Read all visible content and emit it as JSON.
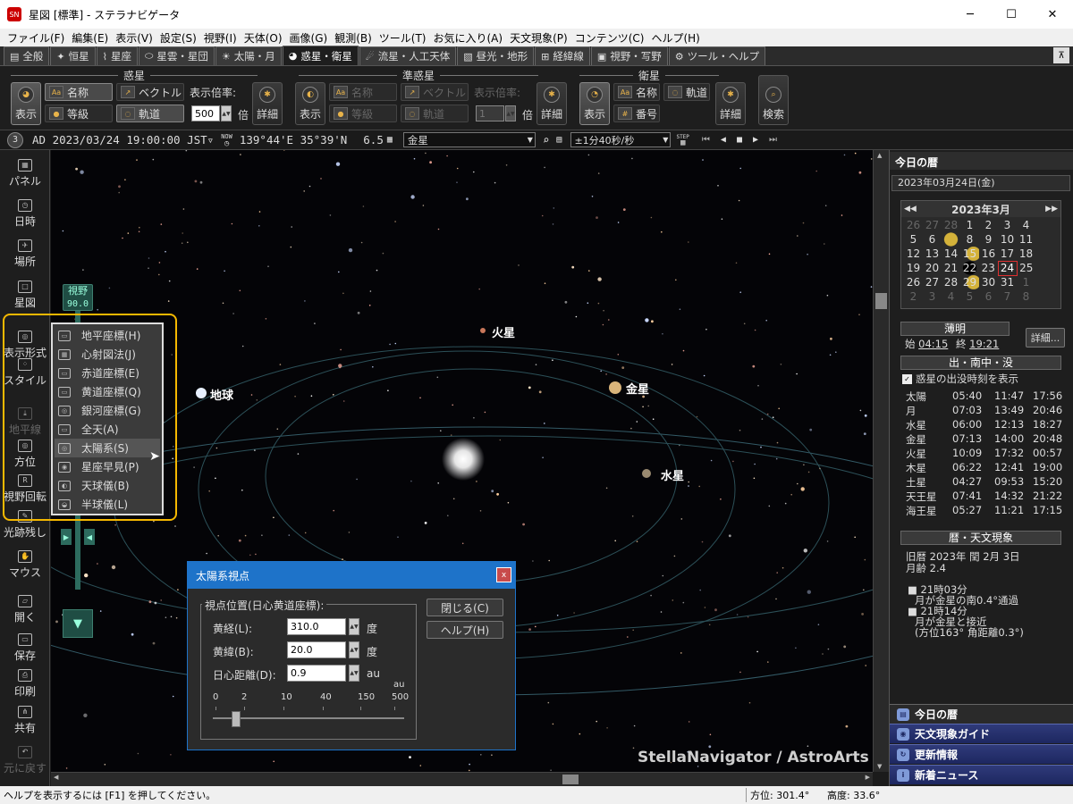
{
  "window": {
    "title": "星図 [標準] - ステラナビゲータ",
    "app_icon": "SN",
    "minimize": "─",
    "maximize": "☐",
    "close": "✕"
  },
  "menu": [
    "ファイル(F)",
    "編集(E)",
    "表示(V)",
    "設定(S)",
    "視野(I)",
    "天体(O)",
    "画像(G)",
    "観測(B)",
    "ツール(T)",
    "お気に入り(A)",
    "天文現象(P)",
    "コンテンツ(C)",
    "ヘルプ(H)"
  ],
  "tabs": [
    {
      "label": "全般",
      "icon": "▤"
    },
    {
      "label": "恒星",
      "icon": "✦"
    },
    {
      "label": "星座",
      "icon": "⌇"
    },
    {
      "label": "星雲・星団",
      "icon": "⬭"
    },
    {
      "label": "太陽・月",
      "icon": "☀"
    },
    {
      "label": "惑星・衛星",
      "icon": "◕",
      "active": true
    },
    {
      "label": "流星・人工天体",
      "icon": "☄"
    },
    {
      "label": "昼光・地形",
      "icon": "▧"
    },
    {
      "label": "経緯線",
      "icon": "⊞"
    },
    {
      "label": "視野・写野",
      "icon": "▣"
    },
    {
      "label": "ツール・ヘルプ",
      "icon": "⚙"
    }
  ],
  "pin": "⊼",
  "ribbon": {
    "groups": [
      "惑星",
      "準惑星",
      "衛星"
    ],
    "show": "表示",
    "detail": "詳細",
    "search": "検索",
    "name": "名称",
    "vector": "ベクトル",
    "grade": "等級",
    "orbit": "軌道",
    "number": "番号",
    "scale_label": "表示倍率:",
    "scale_unit": "倍",
    "scale_value": "500",
    "scale_value_dim": "1"
  },
  "status": {
    "step": "3",
    "datetime": "AD 2023/03/24 19:00:00 JST▿",
    "now": "NOW",
    "location": "139°44'E 35°39'N",
    "mag": "6.5",
    "target": "金星",
    "speed": "±1分40秒/秒",
    "step_label": "STEP"
  },
  "leftbar": [
    {
      "label": "パネル",
      "icon": "▦"
    },
    {
      "label": "日時",
      "icon": "◷"
    },
    {
      "label": "場所",
      "icon": "✈"
    },
    {
      "label": "星図",
      "icon": "□"
    },
    {
      "label": "表示形式",
      "icon": "◎"
    },
    {
      "label": "スタイル",
      "icon": "⁘"
    },
    {
      "label": "地平線",
      "icon": "⤓",
      "dim": true
    },
    {
      "label": "方位",
      "icon": "◎"
    },
    {
      "label": "視野回転",
      "icon": "R"
    },
    {
      "label": "光跡残し",
      "icon": "✎"
    },
    {
      "label": "マウス",
      "icon": "✋"
    },
    {
      "label": "開く",
      "icon": "▱"
    },
    {
      "label": "保存",
      "icon": "▭"
    },
    {
      "label": "印刷",
      "icon": "⎙"
    },
    {
      "label": "共有",
      "icon": "⋔"
    },
    {
      "label": "元に戻す",
      "icon": "↶",
      "dim": true
    }
  ],
  "fov": {
    "label": "視野",
    "value": "90.0"
  },
  "context_menu": [
    "地平座標(H)",
    "心射図法(J)",
    "赤道座標(E)",
    "黄道座標(Q)",
    "銀河座標(G)",
    "全天(A)",
    "太陽系(S)",
    "星座早見(P)",
    "天球儀(B)",
    "半球儀(L)"
  ],
  "planets": {
    "mars": "火星",
    "earth": "地球",
    "venus": "金星",
    "mercury": "水星"
  },
  "watermark": "StellaNavigator / AstroArts",
  "dialog": {
    "title": "太陽系視点",
    "close": "x",
    "group": "視点位置(日心黄道座標):",
    "lon_label": "黄経(L):",
    "lon_value": "310.0",
    "lon_unit": "度",
    "lat_label": "黄緯(B):",
    "lat_value": "20.0",
    "lat_unit": "度",
    "dist_label": "日心距離(D):",
    "dist_value": "0.9",
    "dist_unit": "au",
    "scale_unit": "au",
    "scale_ticks": [
      "0",
      "2",
      "10",
      "40",
      "150",
      "500"
    ],
    "slider_fraction": 0.12,
    "close_btn": "閉じる(C)",
    "help_btn": "ヘルプ(H)"
  },
  "right": {
    "header": "今日の暦",
    "date": "2023年03月24日(金)",
    "cal_title": "2023年3月",
    "cal_prev": "◀◀",
    "cal_next": "▶▶",
    "cal_rows": [
      [
        "26",
        "27",
        "28",
        "1",
        "2",
        "3",
        "4"
      ],
      [
        "5",
        "6",
        "7",
        "8",
        "9",
        "10",
        "11"
      ],
      [
        "12",
        "13",
        "14",
        "15",
        "16",
        "17",
        "18"
      ],
      [
        "19",
        "20",
        "21",
        "22",
        "23",
        "24",
        "25"
      ],
      [
        "26",
        "27",
        "28",
        "29",
        "30",
        "31",
        "1"
      ],
      [
        "2",
        "3",
        "4",
        "5",
        "6",
        "7",
        "8"
      ]
    ],
    "twilight": "薄明",
    "tw_start_label": "始",
    "tw_start": "04:15",
    "tw_end_label": "終",
    "tw_end": "19:21",
    "detail_btn": "詳細...",
    "rise_title": "出・南中・没",
    "rise_check": "惑星の出没時刻を表示",
    "rise_table": [
      [
        "太陽",
        "05:40",
        "11:47",
        "17:56"
      ],
      [
        "月",
        "07:03",
        "13:49",
        "20:46"
      ],
      [
        "水星",
        "06:00",
        "12:13",
        "18:27"
      ],
      [
        "金星",
        "07:13",
        "14:00",
        "20:48"
      ],
      [
        "火星",
        "10:09",
        "17:32",
        "00:57"
      ],
      [
        "木星",
        "06:22",
        "12:41",
        "19:00"
      ],
      [
        "土星",
        "04:27",
        "09:53",
        "15:20"
      ],
      [
        "天王星",
        "07:41",
        "14:32",
        "21:22"
      ],
      [
        "海王星",
        "05:27",
        "11:21",
        "17:15"
      ]
    ],
    "events_title": "暦・天文現象",
    "lunar": "旧暦 2023年 閏 2月 3日",
    "moon_age": "月齢 2.4",
    "events": [
      {
        "time": "21時03分",
        "text": "月が金星の南0.4°通過"
      },
      {
        "time": "21時14分",
        "text": "月が金星と接近",
        "sub": "(方位163° 角距離0.3°)"
      }
    ],
    "acc": [
      "今日の暦",
      "天文現象ガイド",
      "更新情報",
      "新着ニュース"
    ]
  },
  "bottom": {
    "help": "ヘルプを表示するには [F1] を押してください。",
    "azimuth": "方位: 301.4°",
    "altitude": "高度: 33.6°"
  },
  "colors": {
    "accent": "#1e73c9",
    "highlight": "#f5b800",
    "sun": "#ffffff"
  }
}
